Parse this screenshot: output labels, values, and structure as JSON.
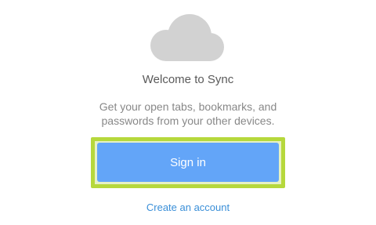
{
  "header": {
    "icon": "cloud-icon",
    "icon_color": "#d2d2d2"
  },
  "welcome": {
    "title": "Welcome to Sync",
    "description_line1": "Get your open tabs, bookmarks, and",
    "description_line2": "passwords from your other devices."
  },
  "actions": {
    "signin_label": "Sign in",
    "signin_color": "#63a5f8",
    "highlight_color": "#b6d83c",
    "create_account_label": "Create an account",
    "link_color": "#3a8fd8"
  }
}
